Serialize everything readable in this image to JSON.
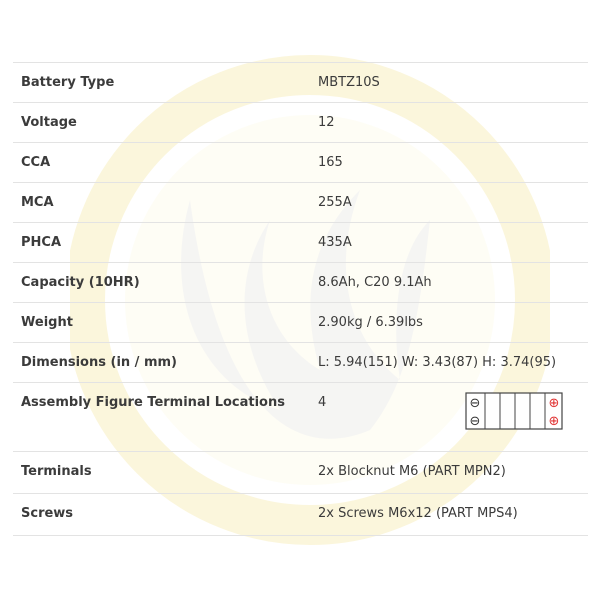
{
  "specs": [
    {
      "label": "Battery Type",
      "value": "MBTZ10S"
    },
    {
      "label": "Voltage",
      "value": "12"
    },
    {
      "label": "CCA",
      "value": "165"
    },
    {
      "label": "MCA",
      "value": "255A"
    },
    {
      "label": "PHCA",
      "value": "435A"
    },
    {
      "label": "Capacity (10HR)",
      "value": "8.6Ah, C20 9.1Ah"
    },
    {
      "label": "Weight",
      "value": "2.90kg / 6.39lbs"
    },
    {
      "label": "Dimensions (in / mm)",
      "value": "L: 5.94(151) W: 3.43(87) H: 3.74(95)"
    },
    {
      "label": "Assembly Figure Terminal Locations",
      "value": "4"
    },
    {
      "label": "Terminals",
      "value": "2x Blocknut M6 (PART MPN2)"
    },
    {
      "label": "Screws",
      "value": "2x Screws M6x12 (PART MPS4)"
    }
  ],
  "terminal_figure": {
    "negative_symbol": "⊖",
    "positive_symbol": "⊕",
    "negative_color": "#333333",
    "positive_color": "#e03030"
  },
  "colors": {
    "text": "#3b3b3b",
    "divider": "#e3e3e3",
    "watermark": "#f7efc6"
  }
}
